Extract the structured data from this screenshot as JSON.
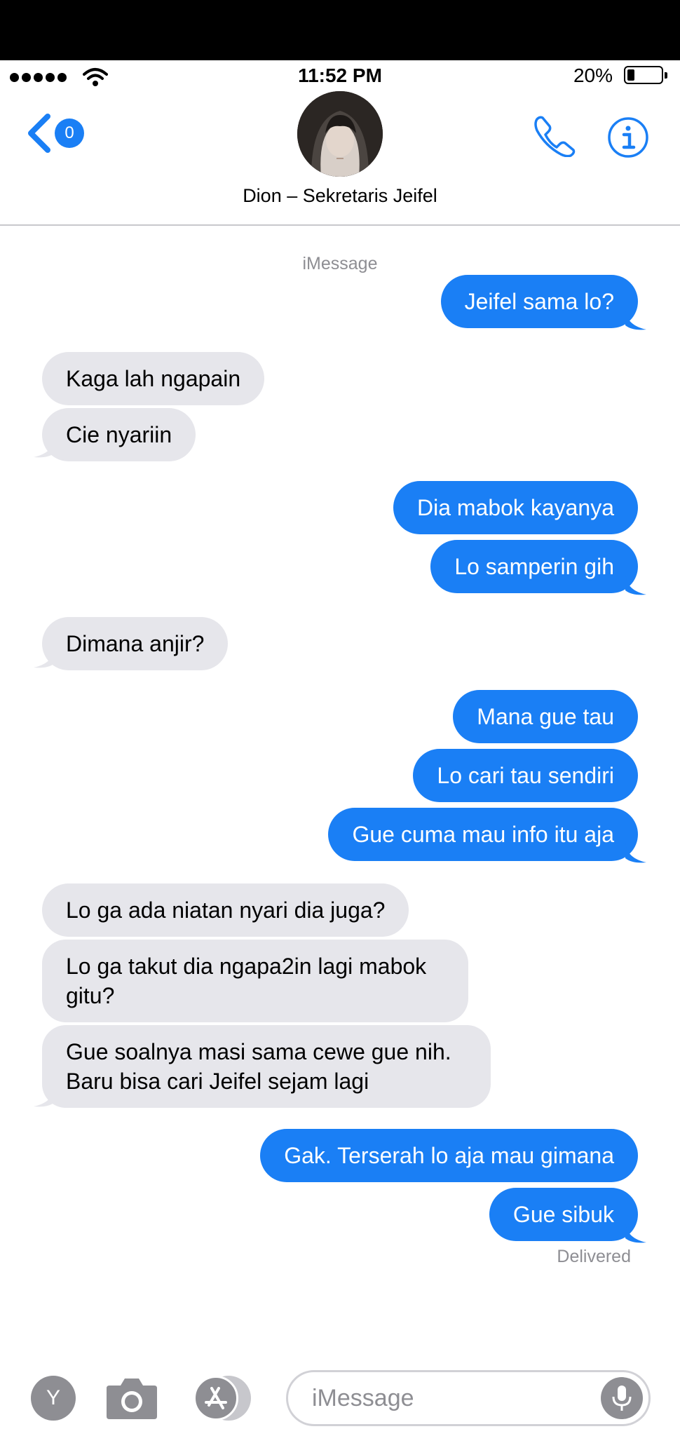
{
  "status": {
    "time": "11:52 PM",
    "battery": "20%"
  },
  "header": {
    "back_badge": "0",
    "contact_name": "Dion – Sekretaris Jeifel"
  },
  "service_label": "iMessage",
  "messages": [
    {
      "from": "me",
      "text": "Jeifel sama lo?"
    },
    {
      "from": "them",
      "text": "Kaga lah ngapain"
    },
    {
      "from": "them",
      "text": "Cie nyariin"
    },
    {
      "from": "me",
      "text": "Dia mabok kayanya"
    },
    {
      "from": "me",
      "text": "Lo samperin gih"
    },
    {
      "from": "them",
      "text": "Dimana anjir?"
    },
    {
      "from": "me",
      "text": "Mana gue tau"
    },
    {
      "from": "me",
      "text": "Lo cari tau sendiri"
    },
    {
      "from": "me",
      "text": "Gue cuma mau info itu aja"
    },
    {
      "from": "them",
      "text": "Lo ga ada niatan nyari dia juga?"
    },
    {
      "from": "them",
      "text": "Lo ga takut dia ngapa2in lagi mabok gitu?"
    },
    {
      "from": "them",
      "text": "Gue soalnya masi sama cewe gue nih. Baru bisa cari Jeifel sejam lagi"
    },
    {
      "from": "me",
      "text": "Gak. Terserah lo aja mau gimana"
    },
    {
      "from": "me",
      "text": "Gue sibuk"
    }
  ],
  "delivered_label": "Delivered",
  "composer": {
    "app_button_label": "Y",
    "placeholder": "iMessage"
  },
  "colors": {
    "outgoing": "#1a7ff5",
    "incoming": "#e6e6eb",
    "accent": "#1a7ff5"
  },
  "icons": [
    "back-chevron-icon",
    "phone-icon",
    "info-icon",
    "camera-icon",
    "app-store-icon",
    "microphone-icon",
    "wifi-icon",
    "battery-icon"
  ]
}
